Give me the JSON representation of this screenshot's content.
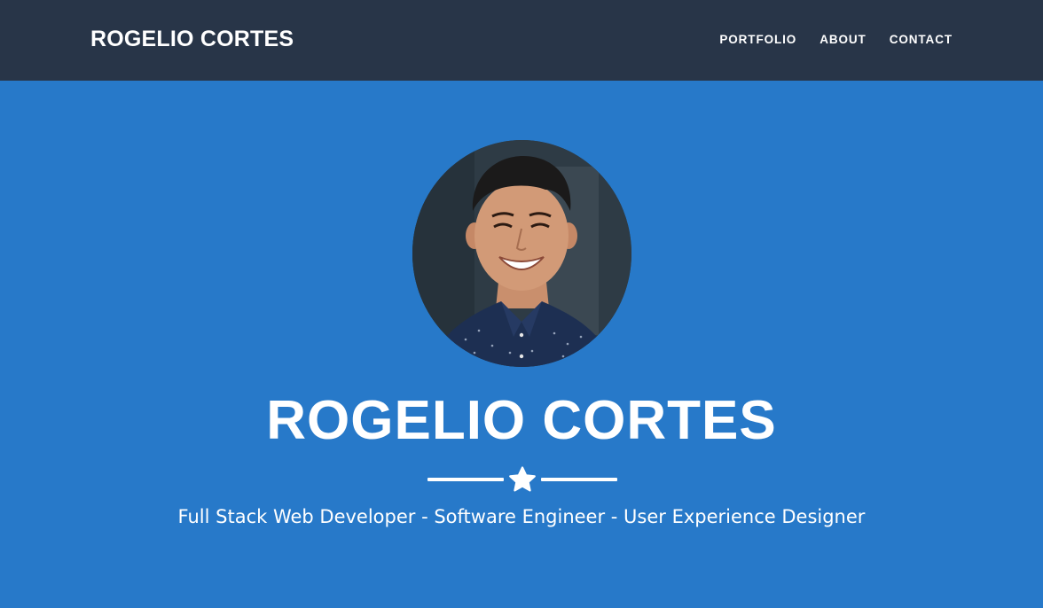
{
  "navbar": {
    "brand": "ROGELIO CORTES",
    "links": [
      {
        "label": "PORTFOLIO"
      },
      {
        "label": "ABOUT"
      },
      {
        "label": "CONTACT"
      }
    ]
  },
  "hero": {
    "title": "ROGELIO CORTES",
    "subtitle": "Full Stack Web Developer - Software Engineer - User Experience Designer",
    "divider_icon": "star-icon",
    "avatar_image": "profile-photo"
  },
  "colors": {
    "navbar_bg": "#283548",
    "hero_bg": "#2779c9",
    "text": "#ffffff"
  }
}
